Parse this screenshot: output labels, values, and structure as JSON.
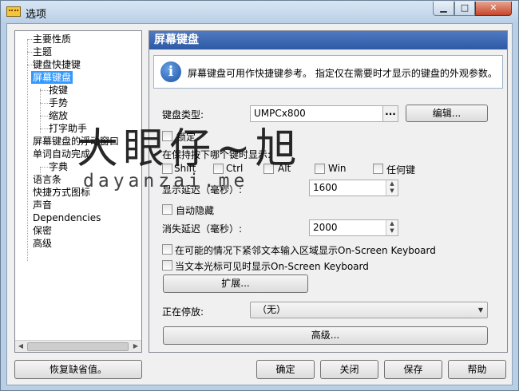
{
  "window": {
    "title": "选项"
  },
  "tree": {
    "items": [
      {
        "label": "主要性质"
      },
      {
        "label": "主题"
      },
      {
        "label": "键盘快捷键"
      },
      {
        "label": "屏幕键盘",
        "selected": true
      },
      {
        "label": "按键"
      },
      {
        "label": "手势"
      },
      {
        "label": "缩放"
      },
      {
        "label": "打字助手"
      },
      {
        "label": "屏幕键盘的浮动窗口"
      },
      {
        "label": "单词自动完成"
      },
      {
        "label": "字典"
      },
      {
        "label": "语言条"
      },
      {
        "label": "快捷方式图标"
      },
      {
        "label": "声音"
      },
      {
        "label": "Dependencies"
      },
      {
        "label": "保密"
      },
      {
        "label": "高级"
      }
    ]
  },
  "panel": {
    "header": "屏幕键盘",
    "info_text": "屏幕键盘可用作快捷键参考。 指定仅在需要时才显示的键盘的外观参数。",
    "keyboard_type": {
      "label": "键盘类型:",
      "value": "UMPCx800",
      "dots": "...",
      "edit_button": "编辑..."
    },
    "lock": {
      "label": "锁定"
    },
    "hold_key_label": "在保持按下哪个键时显示:",
    "modifier_keys": [
      "Shift",
      "Ctrl",
      "Alt",
      "Win",
      "任何键"
    ],
    "show_delay": {
      "label": "显示延迟（毫秒）:",
      "value": "1600"
    },
    "auto_hide": {
      "label": "自动隐藏"
    },
    "hide_delay": {
      "label": "消失延迟（毫秒）:",
      "value": "2000"
    },
    "option_near_text": "在可能的情况下紧邻文本输入区域显示On-Screen Keyboard",
    "option_caret_visible": "当文本光标可见时显示On-Screen Keyboard",
    "extend_button": "扩展...",
    "docking": {
      "label": "正在停放:",
      "value": "（无）"
    },
    "advanced_button": "高级..."
  },
  "footer": {
    "restore_defaults": "恢复缺省值。",
    "ok": "确定",
    "close": "关闭",
    "save": "保存",
    "help": "帮助"
  },
  "watermark": {
    "line1": "大眼仔~旭",
    "line2": "dayanzai.me"
  }
}
